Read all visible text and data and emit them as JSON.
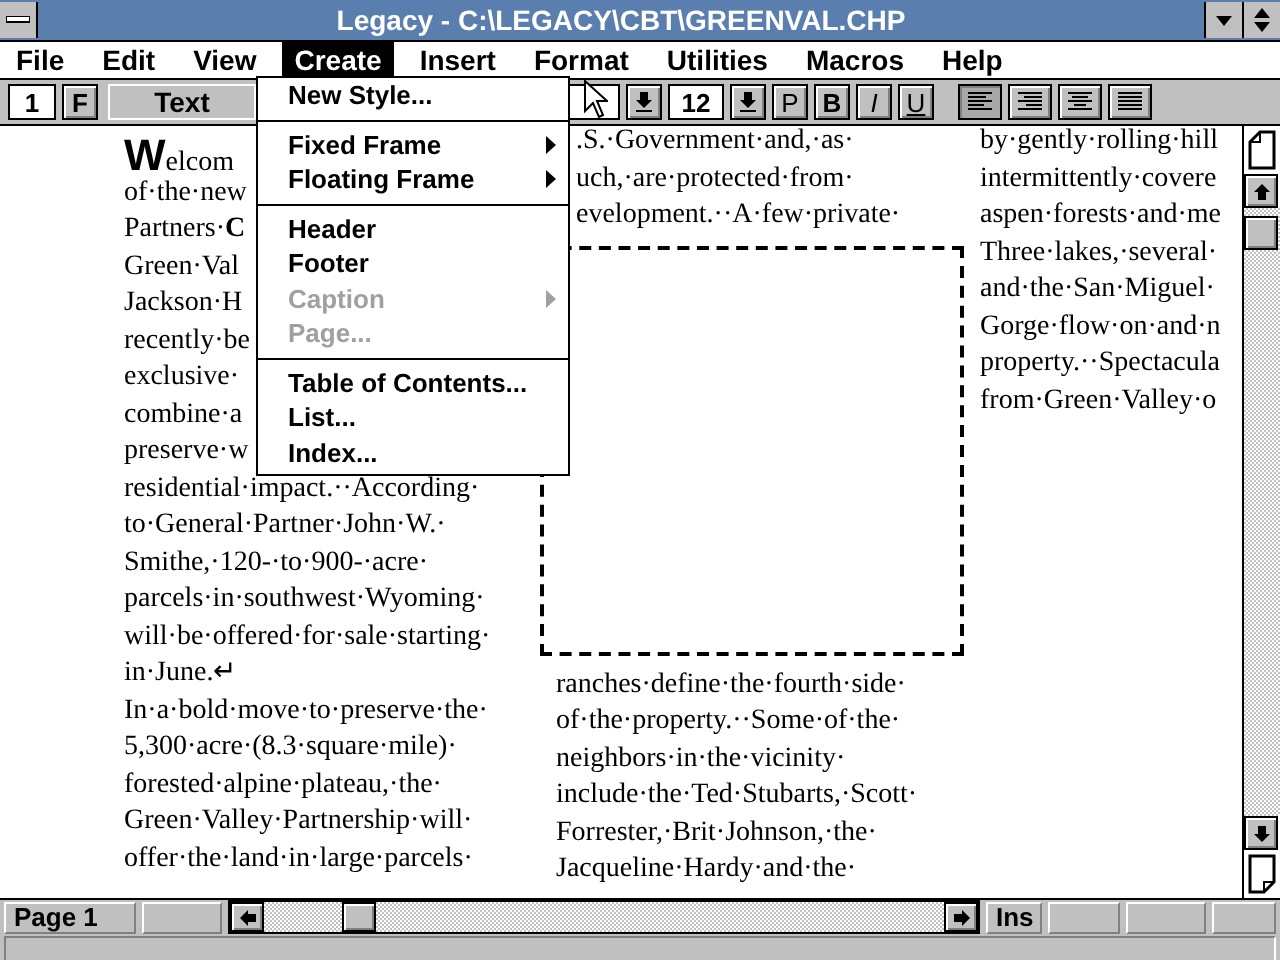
{
  "window": {
    "title": "Legacy - C:\\LEGACY\\CBT\\GREENVAL.CHP"
  },
  "menu_bar": [
    {
      "label": "File",
      "selected": false
    },
    {
      "label": "Edit",
      "selected": false
    },
    {
      "label": "View",
      "selected": false
    },
    {
      "label": "Create",
      "selected": true
    },
    {
      "label": "Insert",
      "selected": false
    },
    {
      "label": "Format",
      "selected": false
    },
    {
      "label": "Utilities",
      "selected": false
    },
    {
      "label": "Macros",
      "selected": false
    },
    {
      "label": "Help",
      "selected": false
    }
  ],
  "toolbar": {
    "page": "1",
    "frame_button": "F",
    "style": "Text",
    "size": "12",
    "format_buttons": [
      "P",
      "B",
      "I",
      "U"
    ],
    "alignments": [
      {
        "kind": "left",
        "selected": true
      },
      {
        "kind": "right",
        "selected": false
      },
      {
        "kind": "center",
        "selected": false
      },
      {
        "kind": "justify",
        "selected": false
      }
    ]
  },
  "create_menu": [
    {
      "kind": "item",
      "label": "New Style...",
      "disabled": false
    },
    {
      "kind": "separator"
    },
    {
      "kind": "submenu",
      "label": "Fixed Frame",
      "disabled": false
    },
    {
      "kind": "submenu",
      "label": "Floating Frame",
      "disabled": false
    },
    {
      "kind": "separator"
    },
    {
      "kind": "item",
      "label": "Header",
      "disabled": false
    },
    {
      "kind": "item",
      "label": "Footer",
      "disabled": false
    },
    {
      "kind": "submenu",
      "label": "Caption",
      "disabled": true
    },
    {
      "kind": "item",
      "label": "Page...",
      "disabled": true
    },
    {
      "kind": "separator"
    },
    {
      "kind": "item",
      "label": "Table of Contents...",
      "disabled": false
    },
    {
      "kind": "item",
      "label": "List...",
      "disabled": false
    },
    {
      "kind": "item",
      "label": "Index...",
      "disabled": false
    }
  ],
  "document": {
    "drop_cap": "W",
    "column_1": [
      "elcom",
      "of·the·new",
      "Partners·**C**",
      "Green·Val",
      "Jackson·H",
      "recently·be",
      "exclusive·",
      "combine·a",
      "preserve·w",
      "residential·impact.··According·",
      "to·General·Partner·John·W.·",
      "Smithe,·120-·to·900-·acre·",
      "parcels·in·southwest·Wyoming·",
      "will·be·offered·for·sale·starting·",
      "in·June.↵",
      "In·a·bold·move·to·preserve·the·",
      "5,300·acre·(8.3·square·mile)·",
      "forested·alpine·plateau,·the·",
      "Green·Valley·Partnership·will·",
      "offer·the·land·in·large·parcels·"
    ],
    "column_2_top": [
      ".S.·Government·and,·as·",
      "uch,·are·protected·from·",
      "evelopment.··A·few·private·"
    ],
    "column_2_bottom": [
      "ranches·define·the·fourth·side·",
      "of·the·property.··Some·of·the·",
      "neighbors·in·the·vicinity·",
      "include·the·Ted·Stubarts,·Scott·",
      "Forrester,·Brit·Johnson,·the·",
      "Jacqueline·Hardy·and·the·"
    ],
    "column_3": [
      "by·gently·rolling·hill",
      "intermittently·covere",
      "aspen·forests·and·me",
      "Three·lakes,·several·",
      "and·the·San·Miguel·",
      "Gorge·flow·on·and·n",
      "property.··Spectacula",
      "from·Green·Valley·o"
    ]
  },
  "status_bar": {
    "page": "Page 1",
    "mode": "Ins"
  }
}
